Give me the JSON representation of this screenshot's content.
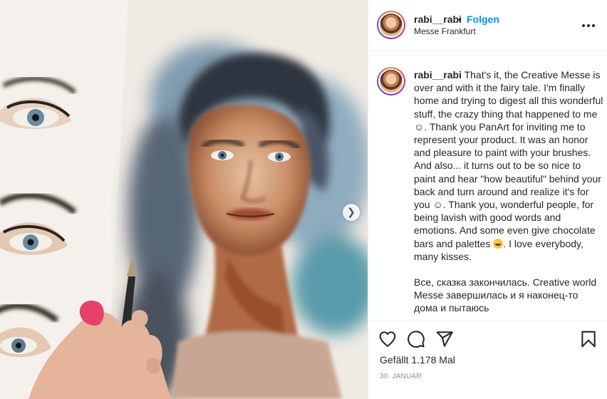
{
  "post": {
    "username": "rabi__rabi",
    "separator": "•",
    "follow_label": "Folgen",
    "location": "Messe Frankfurt",
    "more_icon": "more-horizontal-icon"
  },
  "caption": {
    "username": "rabi__rabi",
    "part1": "That's it, the Creative Messe is over and with it the fairy tale. I'm finally home and trying to digest all this wonderful stuff, the crazy thing that happened to me ☺. Thank you PanArt for inviting me to represent your product. It was an honor and pleasure to paint with your brushes. And also... it turns out to be so nice to paint and hear \"how beautiful\" behind your back and turn around and realize it's for you ☺. Thank you, wonderful people, for being lavish with good words and emotions. And some even give chocolate bars and palettes",
    "part2": ". I love everybody, many kisses.",
    "paragraph2": "Все, сказка закончилась. Creative world Messe завершилась и я наконец-то дома и пытаюсь"
  },
  "actions": {
    "like_icon": "heart-icon",
    "comment_icon": "comment-icon",
    "share_icon": "paper-plane-icon",
    "save_icon": "bookmark-icon"
  },
  "likes_text": "Gefällt 1.178 Mal",
  "date": "30. JANUAR",
  "media": {
    "carousel_next_icon": "chevron-right-icon",
    "carousel_next_glyph": "❯"
  }
}
